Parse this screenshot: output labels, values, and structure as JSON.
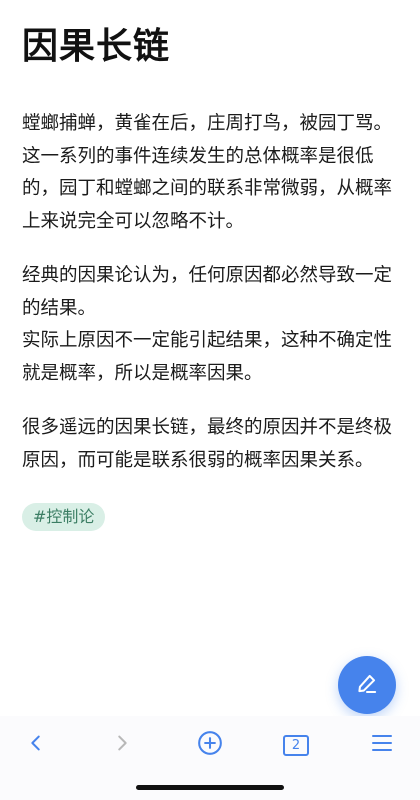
{
  "note": {
    "title": "因果长链",
    "paragraphs": [
      "螳螂捕蝉，黄雀在后，庄周打鸟，被园丁骂。这一系列的事件连续发生的总体概率是很低的，园丁和螳螂之间的联系非常微弱，从概率上来说完全可以忽略不计。",
      "经典的因果论认为，任何原因都必然导致一定的结果。\n实际上原因不一定能引起结果，这种不确定性就是概率，所以是概率因果。",
      "很多遥远的因果长链，最终的原因并不是终极原因，而可能是联系很弱的概率因果关系。"
    ],
    "tag": "#控制论"
  },
  "fab": {
    "icon": "pencil-icon"
  },
  "bottom_nav": {
    "back_icon": "chevron-left-icon",
    "forward_icon": "chevron-right-icon",
    "add_icon": "plus-circle-icon",
    "tab_count": "2",
    "menu_icon": "hamburger-menu-icon"
  },
  "colors": {
    "accent": "#4683ec",
    "tag_bg": "#d9efe6",
    "tag_text": "#3c7e64",
    "forward_disabled": "#b8b8b8"
  }
}
